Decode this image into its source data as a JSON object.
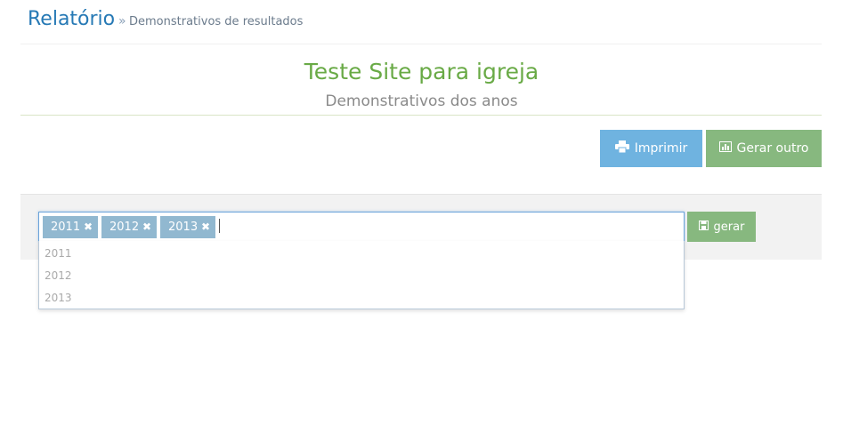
{
  "header": {
    "title": "Relatório",
    "separator": "»",
    "breadcrumb": "Demonstrativos de resultados"
  },
  "report": {
    "title": "Teste Site para igreja",
    "subtitle": "Demonstrativos dos anos"
  },
  "actions": {
    "print_label": "Imprimir",
    "print_icon": "printer-icon",
    "other_label": "Gerar outro",
    "other_icon": "bar-chart-icon"
  },
  "selector": {
    "tags": [
      "2011",
      "2012",
      "2013"
    ],
    "remove_icon": "close-icon",
    "options": [
      "2011",
      "2012",
      "2013"
    ],
    "generate_label": "gerar",
    "generate_icon": "save-icon"
  },
  "colors": {
    "title_blue": "#2679b5",
    "report_green": "#69aa46",
    "print_button": "#6fb3e0",
    "green_button": "#87b87f",
    "tag": "#91b8d0"
  }
}
